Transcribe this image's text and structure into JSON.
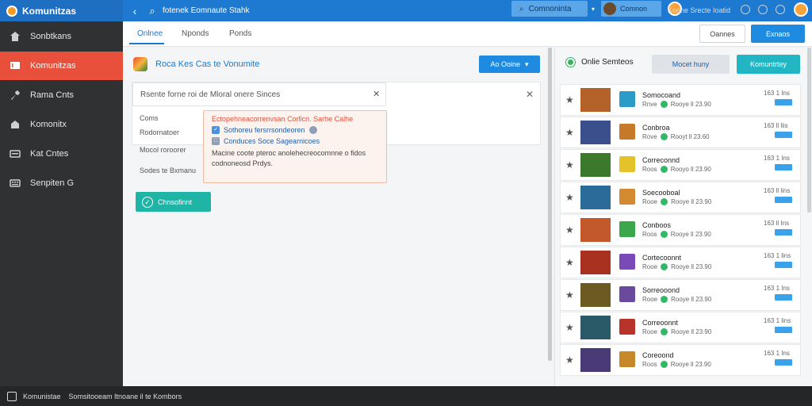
{
  "app": {
    "title": "Komunitzas"
  },
  "sidebar": {
    "items": [
      {
        "label": "Sonbtkans",
        "icon": "home-icon",
        "active": false
      },
      {
        "label": "Komunitzas",
        "icon": "chat-icon",
        "active": true
      },
      {
        "label": "Rama Cnts",
        "icon": "wrench-icon",
        "active": false
      },
      {
        "label": "Komonitx",
        "icon": "house-icon",
        "active": false
      },
      {
        "label": "Kat Cntes",
        "icon": "list-icon",
        "active": false
      },
      {
        "label": "Senpiten G",
        "icon": "keyboard-icon",
        "active": false
      }
    ]
  },
  "topbar": {
    "path": "fotenek Eomnaute Stahk",
    "search_label": "Comnoninta",
    "user_label": "Comnon"
  },
  "tabs": [
    {
      "label": "Onlnee",
      "active": true
    },
    {
      "label": "Nponds",
      "active": false
    },
    {
      "label": "Ponds",
      "active": false
    }
  ],
  "header_buttons": {
    "outline": "Oannes",
    "primary": "Exnaos"
  },
  "main": {
    "title": "Roca Kes Cas te Vonumite",
    "dropdown_label": "Ao Ooine",
    "search_text": "Rsente forne roi de Mloral onere Sinces",
    "form_labels": [
      "Coms",
      "Rodornatoer",
      "Mocol roroorer",
      "Sodes te Bxmanu"
    ],
    "popover": {
      "title": "Ectopehneacorrenvsan Corllcn. Sarhe Calhe",
      "option1": "Sothoreu fersrrsondeoren",
      "option2": "Conduces Soce Sagearnicoes",
      "body_tail": "Macine coote pteroc anolehecreocomnne o fidos codnoneosd Prdys."
    },
    "confirm_label": "Chnsofinnt"
  },
  "right": {
    "title": "Onlie Semteos",
    "filter_label": "Mocet huny",
    "action_label": "Komuntrtey",
    "items": [
      {
        "title": "Somocoand",
        "meta_prefix": "Rnve",
        "meta": "Rooye ll 23.90",
        "count": "163 1 Ins",
        "thumb": "#b5622a",
        "mini": "#2a9cc7"
      },
      {
        "title": "Conbroa",
        "meta_prefix": "Rove",
        "meta": "Rooyt ll 23.60",
        "count": "163 ll liis",
        "thumb": "#3a4f8c",
        "mini": "#c7792a"
      },
      {
        "title": "Correconnd",
        "meta_prefix": "Roos",
        "meta": "Rooyo ll 23.90",
        "count": "163 1 Ins",
        "thumb": "#3b7a2c",
        "mini": "#e3c22a"
      },
      {
        "title": "Soecooboal",
        "meta_prefix": "Rooe",
        "meta": "Rooye ll 23.90",
        "count": "163 ll lins",
        "thumb": "#2b6b9a",
        "mini": "#d48a2e"
      },
      {
        "title": "Conboos",
        "meta_prefix": "Roos",
        "meta": "Rooye ll 23.90",
        "count": "163 ll Ins",
        "thumb": "#c3582a",
        "mini": "#3aa84a"
      },
      {
        "title": "Cortecoonnt",
        "meta_prefix": "Rooe",
        "meta": "Rooye ll 23.90",
        "count": "163 1 lins",
        "thumb": "#a8321f",
        "mini": "#7a4ab8"
      },
      {
        "title": "Sorreooond",
        "meta_prefix": "Rooe",
        "meta": "Rooye ll 23.90",
        "count": "163 1 Ins",
        "thumb": "#6b5a22",
        "mini": "#6a4a9c"
      },
      {
        "title": "Correoonnt",
        "meta_prefix": "Rooe",
        "meta": "Rooye ll 23.90",
        "count": "163 1 lins",
        "thumb": "#2a5a68",
        "mini": "#b8342a"
      },
      {
        "title": "Coreoond",
        "meta_prefix": "Roos",
        "meta": "Rooye ll 23.90",
        "count": "163 1 Ins",
        "thumb": "#4a3a78",
        "mini": "#c7882a"
      }
    ]
  },
  "statusbar": {
    "app": "Komunistae",
    "left_text": "Somsitooeam Itnoane il te Kombors",
    "right_text": "Konne Srecte Ioatid"
  },
  "colors": {
    "accent": "#1e7ad0",
    "active_nav": "#e8503c",
    "confirm": "#1eb5a6"
  }
}
